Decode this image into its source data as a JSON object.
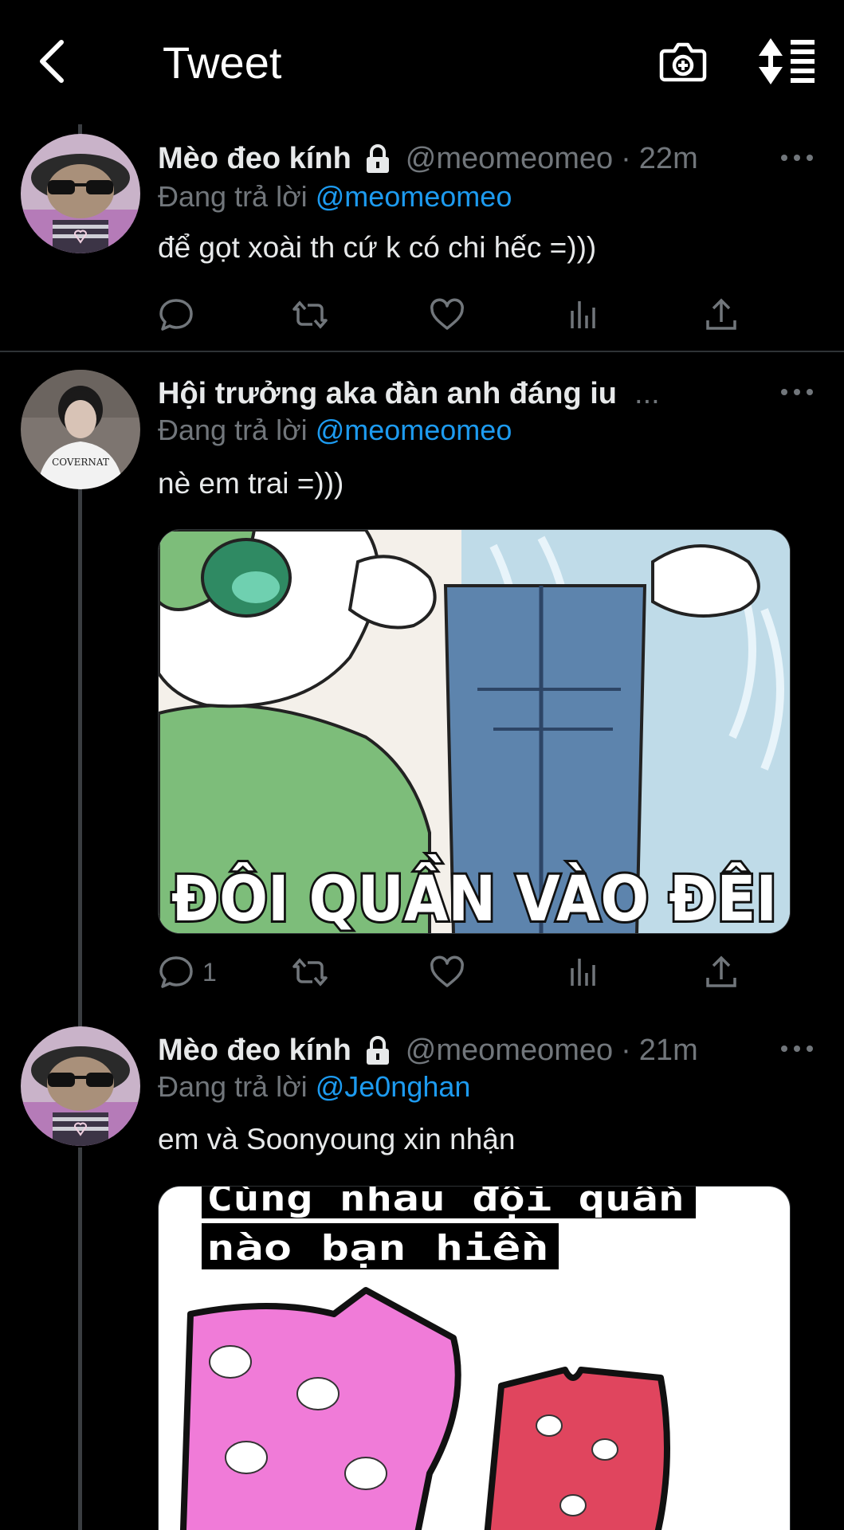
{
  "header": {
    "title": "Tweet",
    "back_icon": "chevron-left-icon",
    "camera_icon": "camera-plus-icon",
    "sort_icon": "sort-list-icon"
  },
  "tweets": [
    {
      "display_name": "Mèo đeo kính",
      "handle": "@meomeomeo",
      "time": "22m",
      "reply_prefix": "Đang trả lời",
      "reply_to": "@meomeomeo",
      "text": "để gọt xoài th cứ k có chi hếc =)))",
      "reply_count": "",
      "locked": true
    },
    {
      "display_name": "Hội trưởng aka đàn anh đáng iu",
      "name_truncation": "...",
      "reply_prefix": "Đang trả lời",
      "reply_to": "@meomeomeo",
      "text": "nè em trai =)))",
      "reply_count": "1",
      "media_caption": "ĐÔI QUẦN VÀO ĐÊI",
      "avatar_shirt_text": "COVERNAT"
    },
    {
      "display_name": "Mèo đeo kính",
      "handle": "@meomeomeo",
      "time": "21m",
      "reply_prefix": "Đang trả lời",
      "reply_to": "@Je0nghan",
      "text": "em và Soonyoung xin nhận",
      "media_caption_line1": "Cùng nhau đội quần",
      "media_caption_line2": "nào bạn hiền",
      "locked": true
    }
  ],
  "colors": {
    "background": "#000000",
    "text": "#e7e9ea",
    "secondary": "#71767b",
    "link": "#1d9bf0",
    "divider": "#2f3336"
  }
}
